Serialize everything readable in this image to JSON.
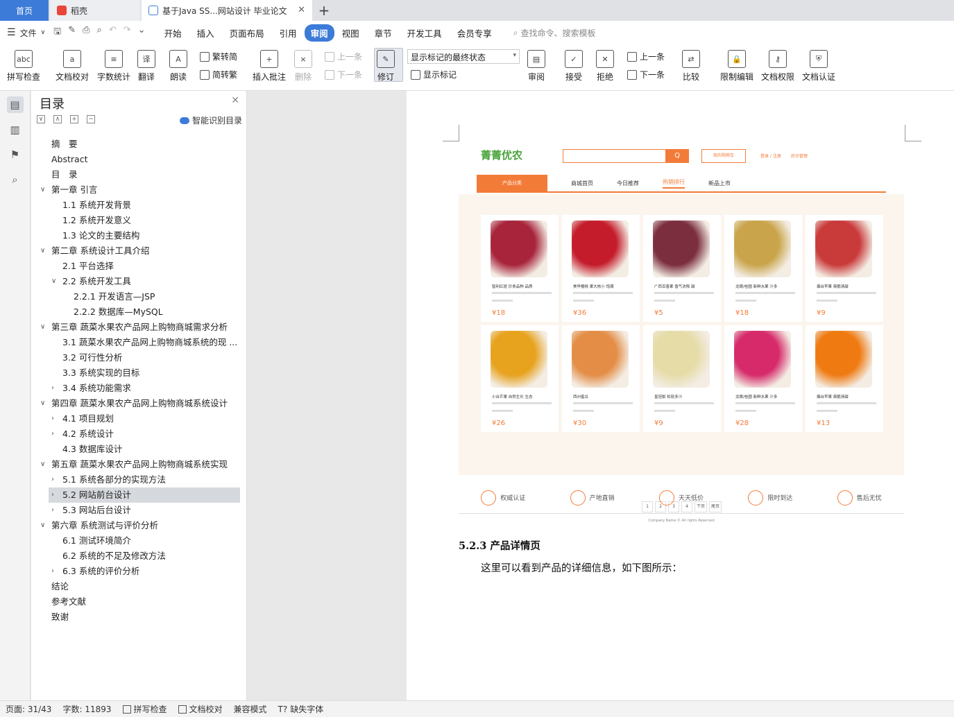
{
  "tabs": {
    "home": "首页",
    "daoke": "稻壳",
    "doc": "基于Java SS...网站设计 毕业论文"
  },
  "menu": {
    "file": "文件",
    "items": [
      "开始",
      "插入",
      "页面布局",
      "引用",
      "审阅",
      "视图",
      "章节",
      "开发工具",
      "会员专享"
    ],
    "search": "查找命令、搜索模板"
  },
  "ribbon": {
    "spell": "拼写检查",
    "proof": "文档校对",
    "count": "字数统计",
    "translate": "翻译",
    "read": "朗读",
    "trad": "繁转简",
    "simp": "简转繁",
    "insert_comment": "插入批注",
    "delete": "删除",
    "prev": "上一条",
    "next": "下一条",
    "revise": "修订",
    "display_state": "显示标记的最终状态",
    "show_marks": "显示标记",
    "review": "审阅",
    "accept": "接受",
    "reject": "拒绝",
    "prev2": "上一条",
    "next2": "下一条",
    "compare": "比较",
    "restrict": "限制编辑",
    "rights": "文档权限",
    "cert": "文档认证"
  },
  "toc": {
    "title": "目录",
    "smart": "智能识别目录",
    "items": [
      {
        "t": "摘　要",
        "l": 0
      },
      {
        "t": "Abstract",
        "l": 0
      },
      {
        "t": "目　录",
        "l": 0
      },
      {
        "t": "第一章 引言",
        "l": 0,
        "c": "v"
      },
      {
        "t": "1.1  系统开发背景",
        "l": 1
      },
      {
        "t": "1.2  系统开发意义",
        "l": 1
      },
      {
        "t": "1.3 论文的主要结构",
        "l": 1
      },
      {
        "t": "第二章 系统设计工具介绍",
        "l": 0,
        "c": "v"
      },
      {
        "t": "2.1  平台选择",
        "l": 1
      },
      {
        "t": "2.2  系统开发工具",
        "l": 1,
        "c": "v"
      },
      {
        "t": "2.2.1  开发语言—JSP",
        "l": 2
      },
      {
        "t": "2.2.2  数据库—MySQL",
        "l": 2
      },
      {
        "t": "第三章 蔬菜水果农产品网上购物商城需求分析",
        "l": 0,
        "c": "v"
      },
      {
        "t": "3.1  蔬菜水果农产品网上购物商城系统的现 ...",
        "l": 1
      },
      {
        "t": "3.2  可行性分析",
        "l": 1
      },
      {
        "t": "3.3  系统实现的目标",
        "l": 1
      },
      {
        "t": "3.4  系统功能需求",
        "l": 1,
        "c": ">"
      },
      {
        "t": "第四章 蔬菜水果农产品网上购物商城系统设计",
        "l": 0,
        "c": "v"
      },
      {
        "t": "4.1  项目规划",
        "l": 1,
        "c": ">"
      },
      {
        "t": "4.2  系统设计",
        "l": 1,
        "c": ">"
      },
      {
        "t": "4.3  数据库设计",
        "l": 1
      },
      {
        "t": "第五章 蔬菜水果农产品网上购物商城系统实现",
        "l": 0,
        "c": "v"
      },
      {
        "t": "5.1  系统各部分的实现方法",
        "l": 1,
        "c": ">"
      },
      {
        "t": "5.2  网站前台设计",
        "l": 1,
        "c": ">",
        "sel": true
      },
      {
        "t": "5.3 网站后台设计",
        "l": 1,
        "c": ">"
      },
      {
        "t": "第六章 系统测试与评价分析",
        "l": 0,
        "c": "v"
      },
      {
        "t": "6.1  测试环境简介",
        "l": 1
      },
      {
        "t": "6.2  系统的不足及修改方法",
        "l": 1
      },
      {
        "t": "6.3  系统的评价分析",
        "l": 1,
        "c": ">"
      },
      {
        "t": "结论",
        "l": 0
      },
      {
        "t": "参考文献",
        "l": 0
      },
      {
        "t": "致谢",
        "l": 0
      }
    ]
  },
  "site": {
    "logo": "菁菁优农",
    "search_btn": "Q",
    "cart": "我的购物车",
    "links": [
      "登录 / 注册",
      "后台管理"
    ],
    "nav_cat": "产品分类",
    "nav": [
      "商城首页",
      "今日推荐",
      "热销排行",
      "新品上市"
    ],
    "products": [
      {
        "name": "智利红提 珍贵品种 品质",
        "price": "¥18",
        "color": "#a7243b"
      },
      {
        "name": "美早樱桃 果大核小 饱满",
        "price": "¥36",
        "color": "#c41c2a"
      },
      {
        "name": "广西百香果 香气浓郁 甜",
        "price": "¥5",
        "color": "#7b2e3e"
      },
      {
        "name": "龙眼/桂圆 新鲜水果 汁多",
        "price": "¥18",
        "color": "#c9a44b"
      },
      {
        "name": "烟台苹果 爽脆清甜",
        "price": "¥9",
        "color": "#c93a3a"
      },
      {
        "name": "小台芒果 自然生长 生态",
        "price": "¥26",
        "color": "#e7a21e"
      },
      {
        "name": "西州蜜瓜",
        "price": "¥30",
        "color": "#e38d46"
      },
      {
        "name": "皇冠梨 松软多汁",
        "price": "¥9",
        "color": "#e6dca8"
      },
      {
        "name": "龙眼/桂圆 新鲜水果 汁多",
        "price": "¥28",
        "color": "#d62a6a"
      },
      {
        "name": "烟台苹果 爽脆清甜",
        "price": "¥13",
        "color": "#ef7a12"
      }
    ],
    "pager": [
      "1",
      "2",
      "3",
      "4",
      "下页",
      "尾页"
    ],
    "features": [
      "权威认证",
      "产地直销",
      "天天低价",
      "限时到达",
      "售后无忧"
    ],
    "copyright": "Company Name © All rights Reserved"
  },
  "doc": {
    "heading": "5.2.3  产品详情页",
    "para": "这里可以看到产品的详细信息，如下图所示："
  },
  "status": {
    "page": "页面: 31/43",
    "words": "字数: 11893",
    "spell": "拼写检查",
    "proof": "文档校对",
    "compat": "兼容模式",
    "font": "缺失字体"
  }
}
